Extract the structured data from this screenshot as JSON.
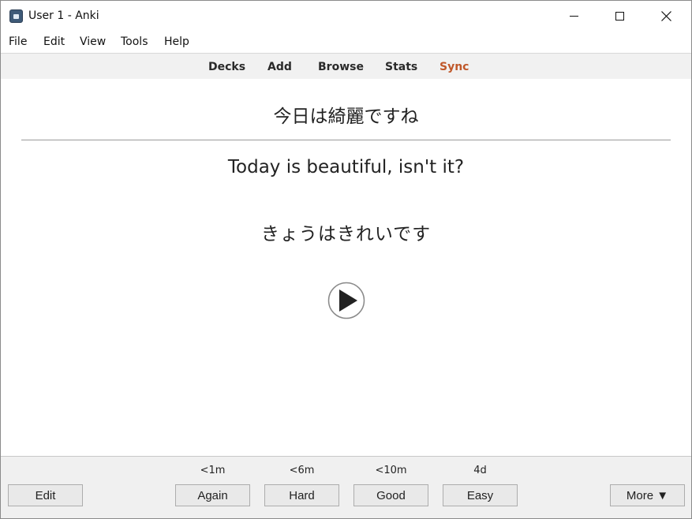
{
  "window": {
    "title": "User 1 - Anki"
  },
  "menu": [
    {
      "label": "File"
    },
    {
      "label": "Edit"
    },
    {
      "label": "View"
    },
    {
      "label": "Tools"
    },
    {
      "label": "Help"
    }
  ],
  "toolbar": {
    "decks": "Decks",
    "add": "Add",
    "browse": "Browse",
    "stats": "Stats",
    "sync": "Sync",
    "sync_color": "#c0582a"
  },
  "card": {
    "front": "今日は綺麗ですね",
    "meaning": "Today is beautiful, isn't it?",
    "reading": "きょうはきれいです",
    "audio_icon": "play-circle-icon"
  },
  "answer": {
    "again_interval": "<1m",
    "hard_interval": "<6m",
    "good_interval": "<10m",
    "easy_interval": "4d",
    "edit_label": "Edit",
    "again_label": "Again",
    "hard_label": "Hard",
    "good_label": "Good",
    "easy_label": "Easy",
    "more_label": "More ▼"
  }
}
